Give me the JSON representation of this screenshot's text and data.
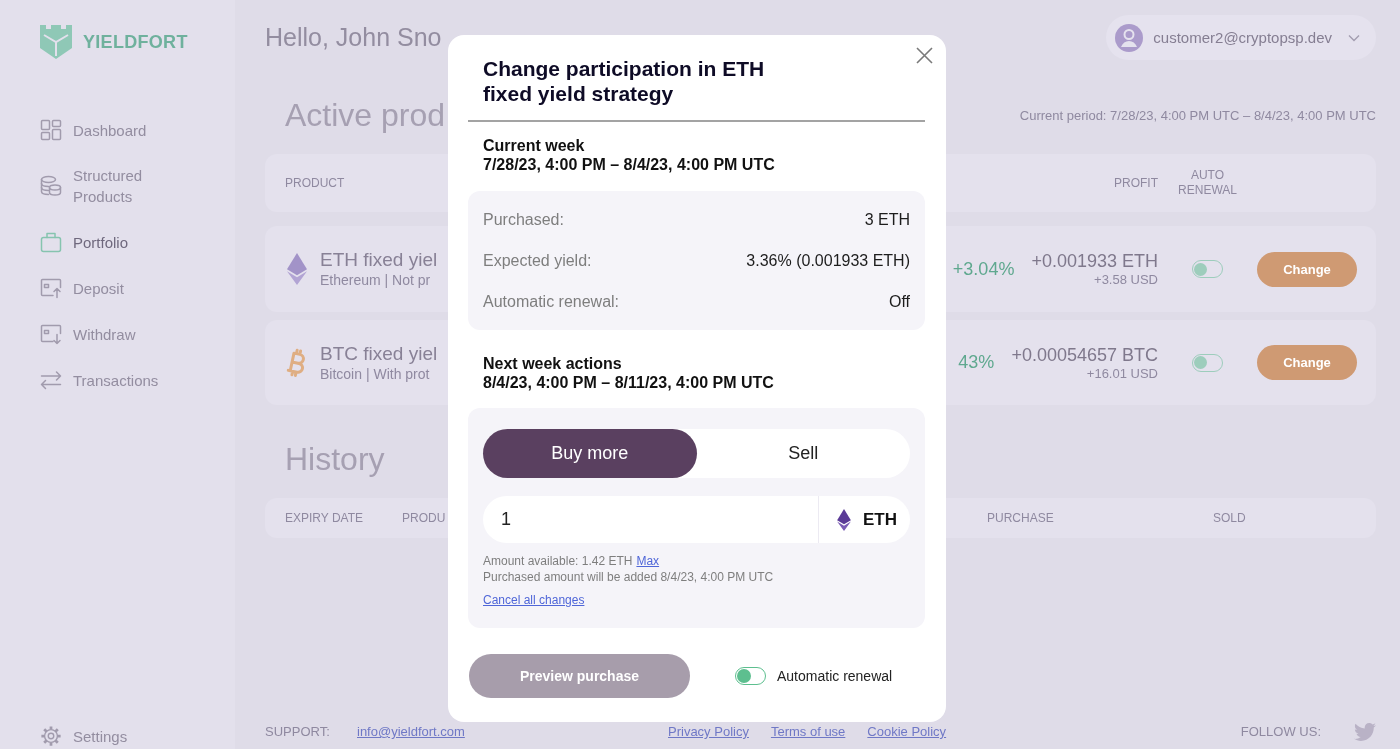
{
  "sidebar": {
    "logo": "YIELDFORT",
    "items": [
      {
        "label": "Dashboard",
        "selected": false
      },
      {
        "label": "Structured Products",
        "selected": false
      },
      {
        "label": "Portfolio",
        "selected": true
      },
      {
        "label": "Deposit",
        "selected": false
      },
      {
        "label": "Withdraw",
        "selected": false
      },
      {
        "label": "Transactions",
        "selected": false
      }
    ],
    "settings": "Settings"
  },
  "header": {
    "greeting": "Hello, John Sno",
    "user_email": "customer2@cryptopsp.dev"
  },
  "active_products": {
    "title": "Active prod",
    "current_period": "Current period: 7/28/23, 4:00 PM UTC – 8/4/23, 4:00 PM UTC",
    "columns": {
      "product": "PRODUCT",
      "profit": "PROFIT",
      "auto_renewal": "AUTO RENEWAL"
    },
    "rows": [
      {
        "name": "ETH fixed yiel",
        "subtitle": "Ethereum | Not pr",
        "change": "+3.04%",
        "profit": "+0.001933 ETH",
        "profit_usd": "+3.58 USD",
        "auto_renewal": false,
        "action": "Change"
      },
      {
        "name": "BTC fixed yiel",
        "subtitle": "Bitcoin | With prot",
        "change": "43%",
        "profit": "+0.00054657 BTC",
        "profit_usd": "+16.01 USD",
        "auto_renewal": false,
        "action": "Change"
      }
    ]
  },
  "history": {
    "title": "History",
    "columns": [
      "EXPIRY DATE",
      "PRODU",
      "PURCHASE",
      "SOLD"
    ]
  },
  "footer": {
    "support_label": "SUPPORT:",
    "support_email": "info@yieldfort.com",
    "links": [
      "Privacy Policy",
      "Terms of use",
      "Cookie Policy"
    ],
    "follow_label": "FOLLOW US:"
  },
  "modal": {
    "title": "Change participation in ETH fixed yield strategy",
    "current_week": {
      "heading": "Current week",
      "period": "7/28/23, 4:00 PM – 8/4/23, 4:00 PM UTC",
      "details": [
        {
          "label": "Purchased:",
          "value": "3 ETH"
        },
        {
          "label": "Expected yield:",
          "value": "3.36% (0.001933 ETH)"
        },
        {
          "label": "Automatic renewal:",
          "value": "Off"
        }
      ]
    },
    "next_week": {
      "heading": "Next week actions",
      "period": "8/4/23, 4:00 PM – 8/11/23, 4:00 PM UTC",
      "tabs": [
        {
          "label": "Buy more",
          "selected": true
        },
        {
          "label": "Sell",
          "selected": false
        }
      ],
      "amount": {
        "value": "1",
        "currency": "ETH"
      },
      "available": "Amount available: 1.42 ETH",
      "max_link": "Max",
      "note": "Purchased amount will be added 8/4/23, 4:00 PM UTC",
      "cancel_link": "Cancel all changes"
    },
    "preview_button": {
      "label": "Preview purchase",
      "disabled": true
    },
    "auto_renewal": {
      "label": "Automatic renewal",
      "on": false
    }
  }
}
